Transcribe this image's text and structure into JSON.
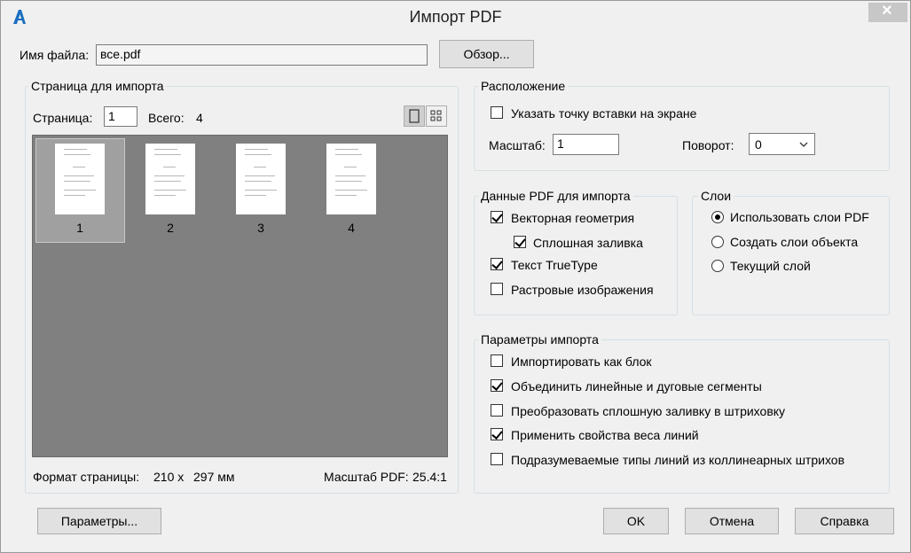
{
  "window": {
    "title": "Импорт PDF",
    "close_glyph": "×"
  },
  "file": {
    "label": "Имя файла:",
    "value": "все.pdf",
    "browse": "Обзор..."
  },
  "page_group": {
    "title": "Страница для импорта",
    "page_label": "Страница:",
    "page_value": "1",
    "total_label": "Всего:",
    "total_value": "4",
    "thumbnails": [
      "1",
      "2",
      "3",
      "4"
    ],
    "selected_index": 0,
    "format_label": "Формат страницы:",
    "format_width": "210 x",
    "format_height": "297 мм",
    "scale_label": "Масштаб PDF:",
    "scale_value": "25.4:1"
  },
  "placement": {
    "title": "Расположение",
    "insert_point": {
      "label": "Указать точку вставки на экране",
      "checked": false
    },
    "scale_label": "Масштаб:",
    "scale_value": "1",
    "rotation_label": "Поворот:",
    "rotation_value": "0"
  },
  "pdf_data": {
    "title": "Данные PDF для импорта",
    "items": [
      {
        "label": "Векторная геометрия",
        "checked": true
      },
      {
        "label": "Сплошная заливка",
        "checked": true
      },
      {
        "label": "Текст TrueType",
        "checked": true
      },
      {
        "label": "Растровые изображения",
        "checked": false
      }
    ]
  },
  "layers": {
    "title": "Слои",
    "options": [
      {
        "label": "Использовать слои PDF",
        "selected": true
      },
      {
        "label": "Создать слои объекта",
        "selected": false
      },
      {
        "label": "Текущий слой",
        "selected": false
      }
    ]
  },
  "import_options": {
    "title": "Параметры импорта",
    "items": [
      {
        "label": "Импортировать как блок",
        "checked": false
      },
      {
        "label": "Объединить линейные и дуговые сегменты",
        "checked": true
      },
      {
        "label": "Преобразовать сплошную заливку в штриховку",
        "checked": false
      },
      {
        "label": "Применить свойства веса линий",
        "checked": true
      },
      {
        "label": "Подразумеваемые типы линий из коллинеарных штрихов",
        "checked": false
      }
    ]
  },
  "footer": {
    "params": "Параметры...",
    "ok": "OK",
    "cancel": "Отмена",
    "help": "Справка"
  },
  "colors": {
    "accent_icon": "#1b6ec2",
    "preview_bg": "#808080"
  }
}
